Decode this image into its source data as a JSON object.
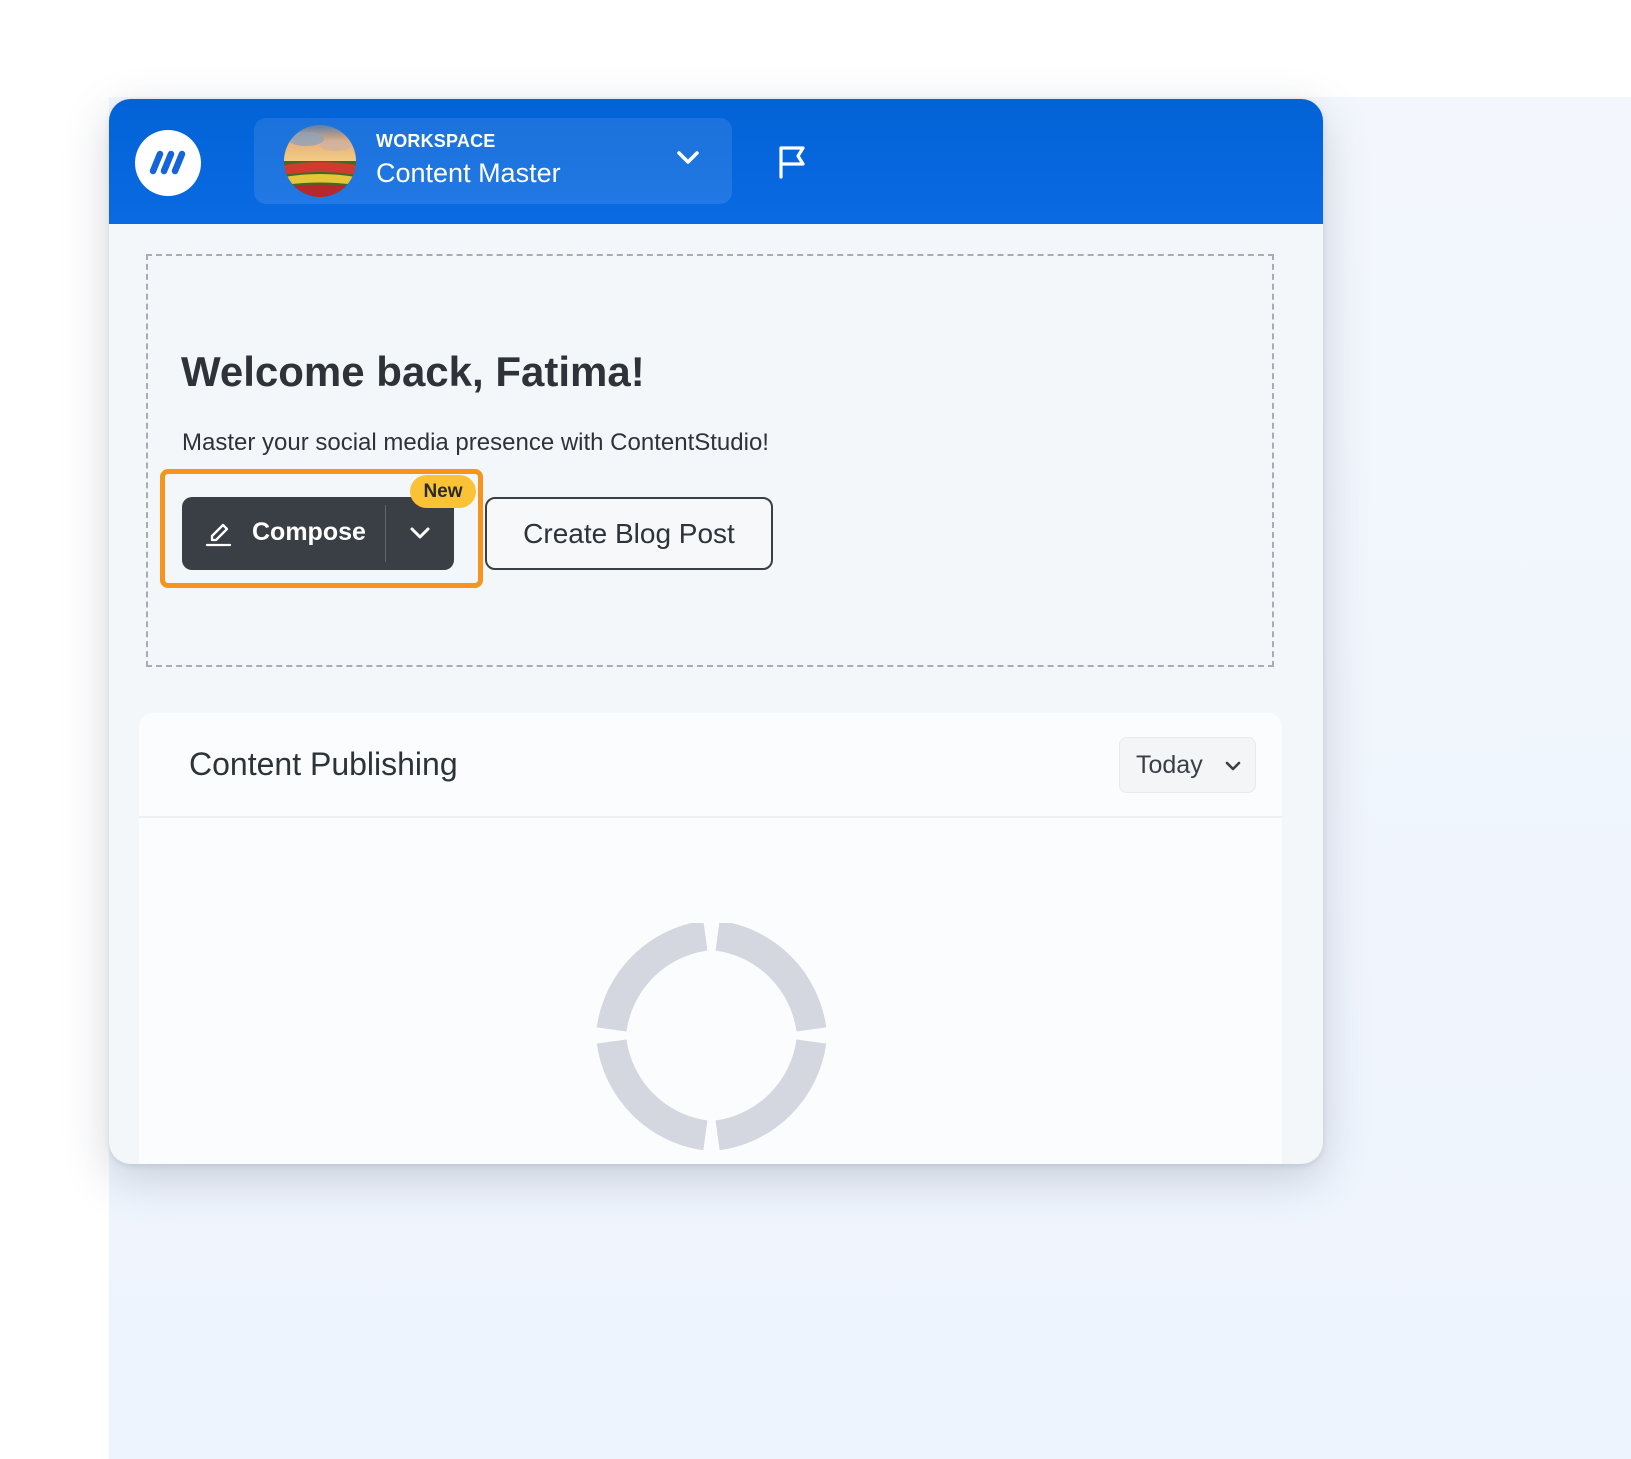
{
  "header": {
    "workspace_eyebrow": "WORKSPACE",
    "workspace_name": "Content Master"
  },
  "welcome": {
    "title": "Welcome back, Fatima!",
    "subtitle": "Master your social media presence with ContentStudio!",
    "compose_label": "Compose",
    "new_badge": "New",
    "create_blog_label": "Create Blog Post"
  },
  "publishing": {
    "title": "Content Publishing",
    "period": "Today"
  },
  "icons": {
    "logo": "contentstudio-logo-icon",
    "workspace_toggle": "chevron-down-icon",
    "flag": "flag-icon",
    "compose": "pen-icon",
    "compose_dropdown": "chevron-down-icon",
    "period_dropdown": "chevron-down-icon",
    "loading": "loading-spinner-icon"
  },
  "colors": {
    "header_blue": "#0262d6",
    "compose_dark": "#3a3f45",
    "highlight_orange": "#f7941d",
    "badge_yellow": "#fcc235",
    "spinner_gray": "#d4d6e0"
  }
}
